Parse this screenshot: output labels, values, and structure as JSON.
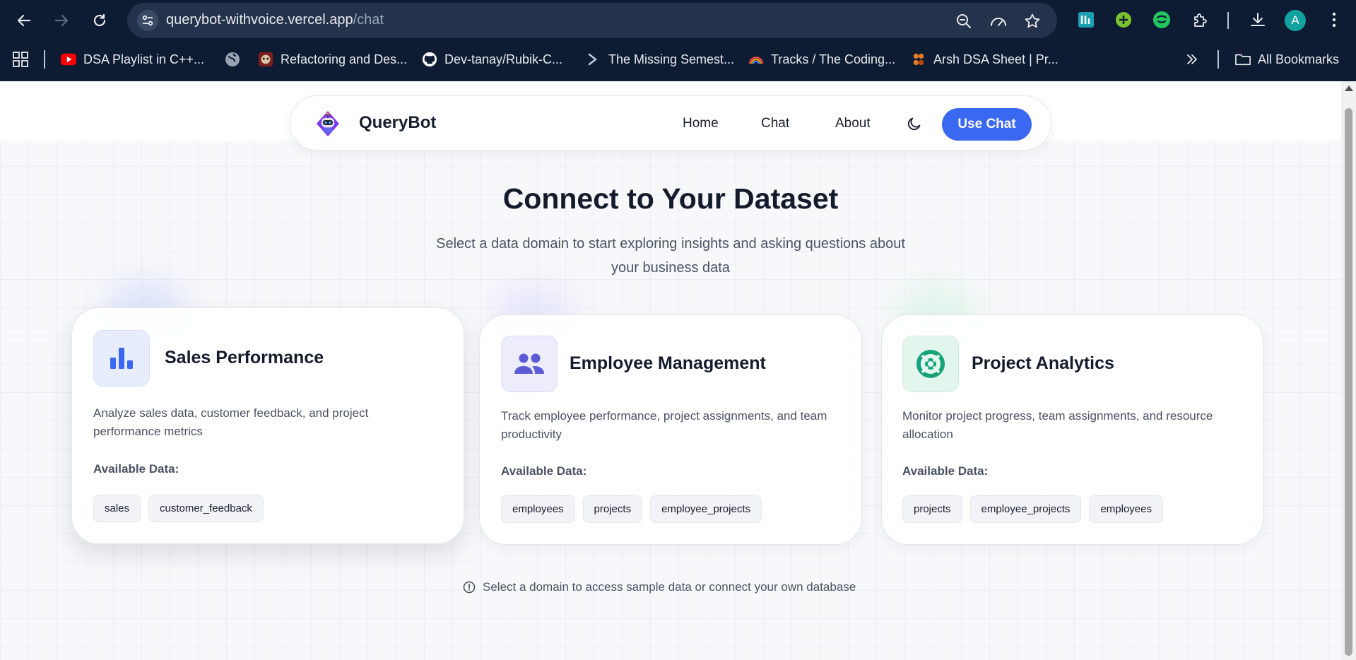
{
  "browser": {
    "url_host": "querybot-withvoice.vercel.app",
    "url_path": "/chat",
    "profile_initial": "A",
    "bookmarks": [
      {
        "label": "DSA Playlist in C++...",
        "icon": "youtube-icon"
      },
      {
        "label": "",
        "icon": "globe-icon"
      },
      {
        "label": "Refactoring and Des...",
        "icon": "refactoring-icon"
      },
      {
        "label": "Dev-tanay/Rubik-C...",
        "icon": "github-icon"
      },
      {
        "label": "The Missing Semest...",
        "icon": "terminal-icon"
      },
      {
        "label": "Tracks / The Coding...",
        "icon": "rainbow-icon"
      },
      {
        "label": "Arsh DSA Sheet | Pr...",
        "icon": "arsh-icon"
      }
    ],
    "all_bookmarks_label": "All Bookmarks"
  },
  "navbar": {
    "brand": "QueryBot",
    "links": [
      "Home",
      "Chat",
      "About"
    ],
    "cta_label": "Use Chat"
  },
  "hero": {
    "title": "Connect to Your Dataset",
    "subtitle": "Select a data domain to start exploring insights and asking questions about your business data"
  },
  "domains": [
    {
      "title": "Sales Performance",
      "icon": "bar-chart-icon",
      "description": "Analyze sales data, customer feedback, and project performance metrics",
      "available_label": "Available Data:",
      "tables": [
        "sales",
        "customer_feedback"
      ]
    },
    {
      "title": "Employee Management",
      "icon": "people-icon",
      "description": "Track employee performance, project assignments, and team productivity",
      "available_label": "Available Data:",
      "tables": [
        "employees",
        "projects",
        "employee_projects"
      ]
    },
    {
      "title": "Project Analytics",
      "icon": "lifebuoy-icon",
      "description": "Monitor project progress, team assignments, and resource allocation",
      "available_label": "Available Data:",
      "tables": [
        "projects",
        "employee_projects",
        "employees"
      ]
    }
  ],
  "footer_note": "Select a domain to access sample data or connect your own database",
  "colors": {
    "chrome_bg": "#0d1b33",
    "accent": "#3b68f0",
    "sales_icon": "#3b68f0",
    "employee_icon": "#5b5bd6",
    "project_icon": "#16a37a"
  }
}
